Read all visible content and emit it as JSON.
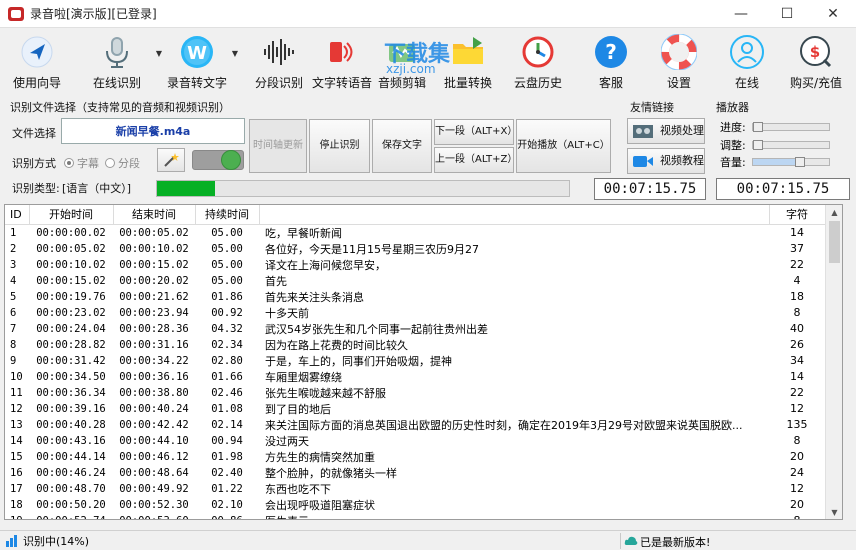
{
  "window": {
    "title": "录音啦[演示版][已登录]",
    "minimize": "—",
    "maximize": "☐",
    "close": "✕"
  },
  "toolbar": {
    "items": [
      {
        "label": "使用向导",
        "icon": "navigate-arrow-icon"
      },
      {
        "label": "在线识别",
        "icon": "microphone-icon"
      },
      {
        "label": "录音转文字",
        "icon": "word-w-icon"
      },
      {
        "label": "分段识别",
        "icon": "waveform-icon"
      },
      {
        "label": "文字转语音",
        "icon": "text-to-speech-icon"
      },
      {
        "label": "音频剪辑",
        "icon": "audio-edit-icon"
      },
      {
        "label": "批量转换",
        "icon": "batch-convert-icon"
      },
      {
        "label": "云盘历史",
        "icon": "cloud-history-icon"
      },
      {
        "label": "客服",
        "icon": "help-question-icon"
      },
      {
        "label": "设置",
        "icon": "lifebuoy-settings-icon"
      },
      {
        "label": "在线",
        "icon": "user-online-icon"
      },
      {
        "label": "购买/充值",
        "icon": "purchase-icon"
      }
    ],
    "watermark_text": "下载集",
    "watermark_sub": "xzji.com"
  },
  "recognize": {
    "group_title": "识别文件选择（支持常见的音频和视频识别）",
    "file_label": "文件选择",
    "file_name": "新闻早餐.m4a",
    "method_label": "识别方式",
    "radio_subtitle": "字幕",
    "radio_segment": "分段",
    "timeline_btn": "时间轴更新",
    "stop_btn": "停止识别",
    "save_btn": "保存文字",
    "next_btn": "下一段（ALT+X）",
    "prev_btn": "上一段（ALT+Z）",
    "play_btn": "开始播放（ALT+C）",
    "type_label": "识别类型:",
    "type_value": "[语言（中文）]",
    "progress_percent": 14,
    "time_left": "00:07:15.75",
    "time_right": "00:07:15.75"
  },
  "friend_links": {
    "group_title": "友情链接",
    "video_process": "视频处理",
    "video_tutorial": "视频教程"
  },
  "player": {
    "group_title": "播放器",
    "progress_label": "进度:",
    "adjust_label": "调整:",
    "volume_label": "音量:",
    "progress_value": 0.0,
    "adjust_value": 0.0,
    "volume_value": 0.6
  },
  "table": {
    "headers": [
      "ID",
      "开始时间",
      "结束时间",
      "持续时间",
      "",
      "字符"
    ],
    "rows": [
      [
        "1",
        "00:00:00.02",
        "00:00:05.02",
        "05.00",
        "吃，早餐听新闻",
        "14"
      ],
      [
        "2",
        "00:00:05.02",
        "00:00:10.02",
        "05.00",
        "各位好，今天是11月15号星期三农历9月27",
        "37"
      ],
      [
        "3",
        "00:00:10.02",
        "00:00:15.02",
        "05.00",
        "译文在上海问候您早安，",
        "22"
      ],
      [
        "4",
        "00:00:15.02",
        "00:00:20.02",
        "05.00",
        "首先",
        "4"
      ],
      [
        "5",
        "00:00:19.76",
        "00:00:21.62",
        "01.86",
        "首先来关注头条消息",
        "18"
      ],
      [
        "6",
        "00:00:23.02",
        "00:00:23.94",
        "00.92",
        "十多天前",
        "8"
      ],
      [
        "7",
        "00:00:24.04",
        "00:00:28.36",
        "04.32",
        "武汉54岁张先生和几个同事一起前往贵州出差",
        "40"
      ],
      [
        "8",
        "00:00:28.82",
        "00:00:31.16",
        "02.34",
        "因为在路上花费的时间比较久",
        "26"
      ],
      [
        "9",
        "00:00:31.42",
        "00:00:34.22",
        "02.80",
        "于是，车上的，同事们开始吸烟，提神",
        "34"
      ],
      [
        "10",
        "00:00:34.50",
        "00:00:36.16",
        "01.66",
        "车厢里烟雾缭绕",
        "14"
      ],
      [
        "11",
        "00:00:36.34",
        "00:00:38.80",
        "02.46",
        "张先生喉咙越来越不舒服",
        "22"
      ],
      [
        "12",
        "00:00:39.16",
        "00:00:40.24",
        "01.08",
        "到了目的地后",
        "12"
      ],
      [
        "13",
        "00:00:40.28",
        "00:00:42.42",
        "02.14",
        "来关注国际方面的消息英国退出欧盟的历史性时刻，确定在2019年3月29号对欧盟来说英国脱欧...",
        "135"
      ],
      [
        "14",
        "00:00:43.16",
        "00:00:44.10",
        "00.94",
        "没过两天",
        "8"
      ],
      [
        "15",
        "00:00:44.14",
        "00:00:46.12",
        "01.98",
        "方先生的病情突然加重",
        "20"
      ],
      [
        "16",
        "00:00:46.24",
        "00:00:48.64",
        "02.40",
        "整个脸肿，的就像猪头一样",
        "24"
      ],
      [
        "17",
        "00:00:48.70",
        "00:00:49.92",
        "01.22",
        "东西也吃不下",
        "12"
      ],
      [
        "18",
        "00:00:50.20",
        "00:00:52.30",
        "02.10",
        "会出现呼吸道阻塞症状",
        "20"
      ],
      [
        "19",
        "00:00:52.74",
        "00:00:53.60",
        "00.86",
        "医生表示",
        "8"
      ],
      [
        "20",
        "00:00:53.70",
        "00:00:58.12",
        "04.42",
        "方先生的发病如此迅速且范围如此巨大，极为罕见",
        "44"
      ]
    ]
  },
  "status": {
    "left": "识别中(14%)",
    "right": "已是最新版本!"
  },
  "colors": {
    "progress_fill": "#06b025",
    "toggle_green": "#4caf50",
    "file_name_color": "#1a3fa8"
  }
}
